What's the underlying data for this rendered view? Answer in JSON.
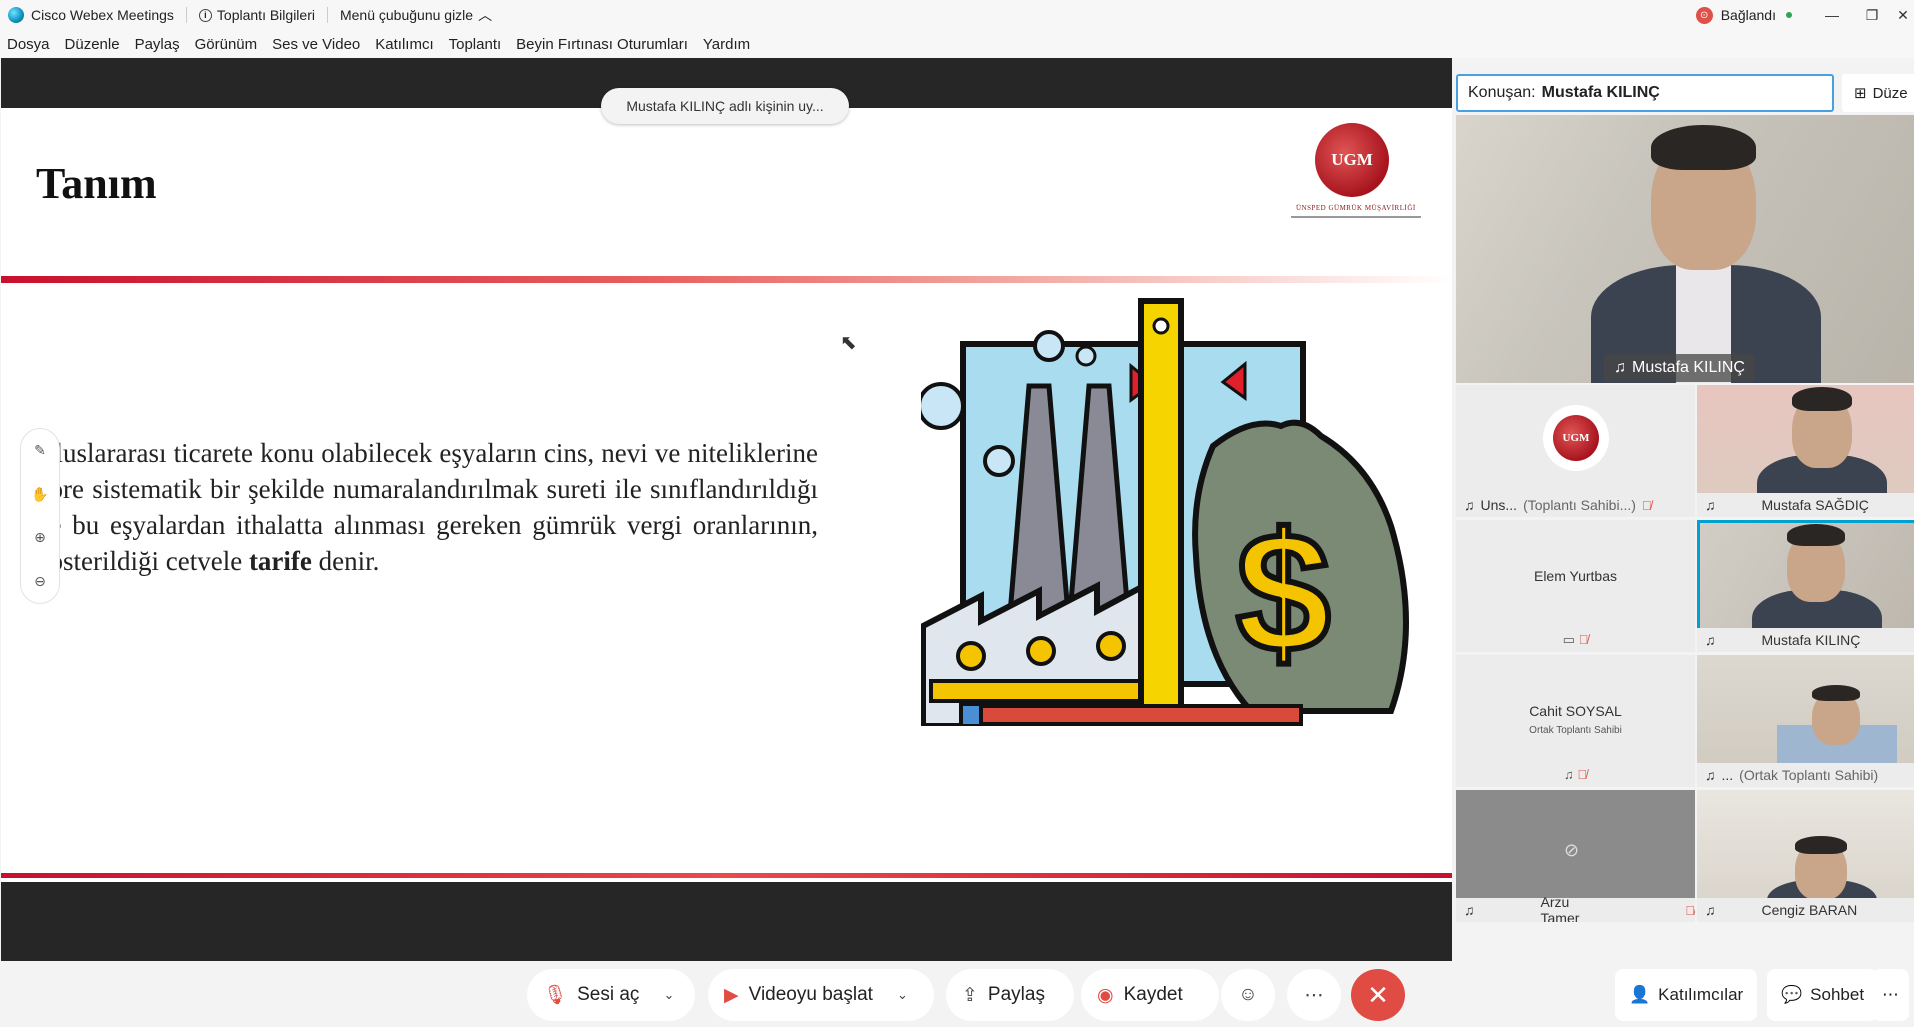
{
  "titlebar": {
    "app_name": "Cisco Webex Meetings",
    "meeting_info": "Toplantı Bilgileri",
    "hide_menu": "Menü çubuğunu gizle",
    "connection": "Bağlandı"
  },
  "menu": [
    "Dosya",
    "Düzenle",
    "Paylaş",
    "Görünüm",
    "Ses ve Video",
    "Katılımcı",
    "Toplantı",
    "Beyin Fırtınası Oturumları",
    "Yardım"
  ],
  "share": {
    "sharer_pill": "Mustafa KILINÇ adlı kişinin uy...",
    "slide_title": "Tanım",
    "logo_text": "UGM",
    "logo_subtext": "ÜNSPED GÜMRÜK MÜŞAVİRLİĞİ",
    "paragraph_pre": "Uluslararası ticarete konu olabilecek eşyaların cins, nevi ve niteliklerine göre sistematik bir şekilde numaralandırılmak sureti ile sınıflandırıldığı ve bu eşyalardan ithalatta alınması gereken gümrük vergi oranlarının, gösterildiği cetvele ",
    "paragraph_bold": "tarife",
    "paragraph_post": " denir."
  },
  "panel": {
    "speaking_label": "Konuşan:",
    "speaking_name": "Mustafa KILINÇ",
    "layout_label": "Düze",
    "active_name": "Mustafa KILINÇ",
    "tiles": [
      {
        "label": "Uns...",
        "role": "(Toplantı Sahibi...)"
      },
      {
        "label": "Mustafa SAĞDIÇ"
      },
      {
        "center": "Elem Yurtbas"
      },
      {
        "label": "Mustafa KILINÇ"
      },
      {
        "center": "Cahit SOYSAL",
        "role": "Ortak Toplantı Sahibi"
      },
      {
        "label": "...",
        "role": "(Ortak Toplantı Sahibi)"
      },
      {
        "label": "Arzu Tamer"
      },
      {
        "label": "Cengiz BARAN"
      }
    ]
  },
  "bottom": {
    "unmute": "Sesi aç",
    "start_video": "Videoyu başlat",
    "share": "Paylaş",
    "record": "Kaydet",
    "participants": "Katılımcılar",
    "chat": "Sohbet"
  }
}
